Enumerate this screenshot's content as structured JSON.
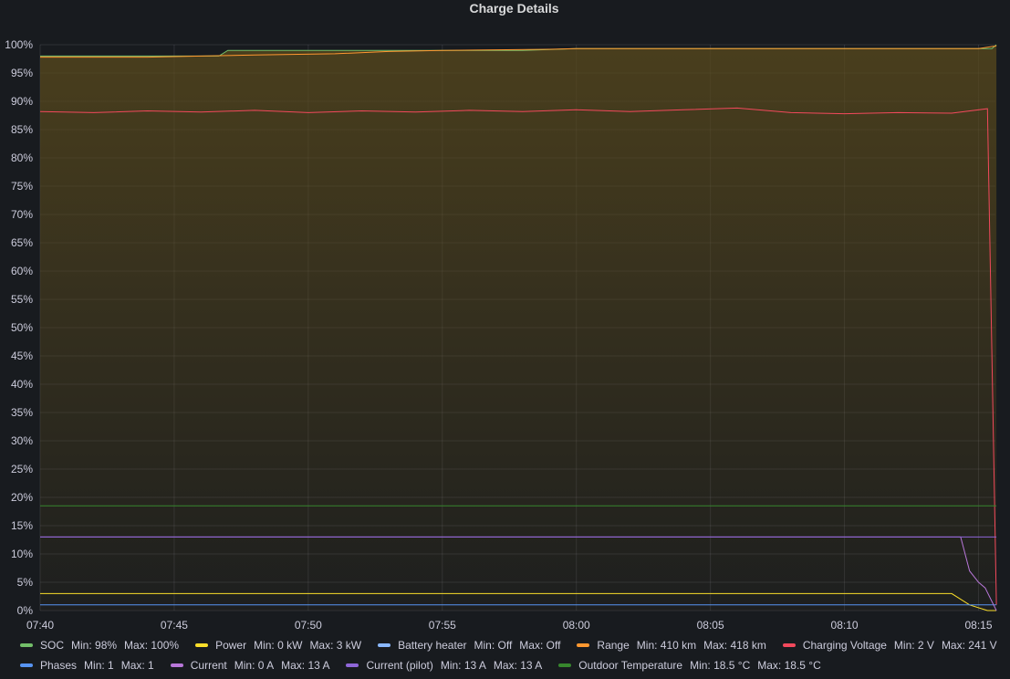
{
  "panel": {
    "title": "Charge Details"
  },
  "chart_data": {
    "type": "line",
    "title": "Charge Details",
    "xlabel": "",
    "ylabel": "",
    "ylim": [
      0,
      100
    ],
    "xlim": [
      "07:40",
      "08:16"
    ],
    "y_ticks": [
      "0%",
      "5%",
      "10%",
      "15%",
      "20%",
      "25%",
      "30%",
      "35%",
      "40%",
      "45%",
      "50%",
      "55%",
      "60%",
      "65%",
      "70%",
      "75%",
      "80%",
      "85%",
      "90%",
      "95%",
      "100%"
    ],
    "x_ticks": [
      "07:40",
      "07:45",
      "07:50",
      "07:55",
      "08:00",
      "08:05",
      "08:10",
      "08:15"
    ],
    "grid": true,
    "legend_position": "bottom",
    "series": [
      {
        "name": "SOC",
        "color": "#73bf69",
        "stats": {
          "min_label": "Min:",
          "min": "98%",
          "max_label": "Max:",
          "max": "100%"
        },
        "x": [
          "07:40",
          "07:46:40",
          "07:47",
          "07:52",
          "07:58",
          "08:00",
          "08:15:30",
          "08:15:40"
        ],
        "values": [
          98,
          98,
          99,
          99,
          99,
          99.3,
          99.3,
          100
        ],
        "fill": true
      },
      {
        "name": "Power",
        "color": "#fade2a",
        "stats": {
          "min_label": "Min:",
          "min": "0 kW",
          "max_label": "Max:",
          "max": "3 kW"
        },
        "x": [
          "07:40",
          "08:14",
          "08:14:40",
          "08:15:20",
          "08:15:40"
        ],
        "values": [
          3,
          3,
          1,
          0,
          0
        ]
      },
      {
        "name": "Battery heater",
        "color": "#8ab8ff",
        "stats": {
          "min_label": "Min:",
          "min": "Off",
          "max_label": "Max:",
          "max": "Off"
        },
        "x": [],
        "values": []
      },
      {
        "name": "Range",
        "color": "#ff9830",
        "stats": {
          "min_label": "Min:",
          "min": "410 km",
          "max_label": "Max:",
          "max": "418 km"
        },
        "x": [
          "07:40",
          "07:44",
          "07:46",
          "07:48",
          "07:51",
          "07:53",
          "07:55",
          "07:57",
          "07:59",
          "08:00",
          "08:15",
          "08:15:40"
        ],
        "values": [
          97.8,
          97.8,
          98,
          98.2,
          98.4,
          98.8,
          99,
          99.1,
          99.2,
          99.3,
          99.3,
          99.8
        ]
      },
      {
        "name": "Charging Voltage",
        "color": "#f2495c",
        "stats": {
          "min_label": "Min:",
          "min": "2 V",
          "max_label": "Max:",
          "max": "241 V"
        },
        "x": [
          "07:40",
          "07:42",
          "07:44",
          "07:46",
          "07:48",
          "07:50",
          "07:52",
          "07:54",
          "07:56",
          "07:58",
          "08:00",
          "08:02",
          "08:04",
          "08:06",
          "08:08",
          "08:10",
          "08:12",
          "08:14",
          "08:15:20",
          "08:15:40"
        ],
        "values": [
          88.2,
          88.0,
          88.3,
          88.1,
          88.4,
          88.0,
          88.3,
          88.1,
          88.4,
          88.2,
          88.5,
          88.2,
          88.5,
          88.8,
          88.0,
          87.8,
          88.0,
          87.9,
          88.7,
          1
        ]
      },
      {
        "name": "Phases",
        "color": "#5794f2",
        "stats": {
          "min_label": "Min:",
          "min": "1",
          "max_label": "Max:",
          "max": "1"
        },
        "x": [
          "07:40",
          "08:15:40"
        ],
        "values": [
          1,
          1
        ]
      },
      {
        "name": "Current",
        "color": "#b877d9",
        "stats": {
          "min_label": "Min:",
          "min": "0 A",
          "max_label": "Max:",
          "max": "13 A"
        },
        "x": [
          "07:40",
          "08:14:20",
          "08:14:40",
          "08:15",
          "08:15:15",
          "08:15:40"
        ],
        "values": [
          13,
          13,
          7,
          5,
          4,
          0
        ]
      },
      {
        "name": "Current (pilot)",
        "color": "#8f66d8",
        "stats": {
          "min_label": "Min:",
          "min": "13 A",
          "max_label": "Max:",
          "max": "13 A"
        },
        "x": [
          "07:40",
          "08:15:40"
        ],
        "values": [
          13,
          13
        ]
      },
      {
        "name": "Outdoor Temperature",
        "color": "#37872d",
        "stats": {
          "min_label": "Min:",
          "min": "18.5 °C",
          "max_label": "Max:",
          "max": "18.5 °C"
        },
        "x": [
          "07:40",
          "08:15:40"
        ],
        "values": [
          18.5,
          18.5
        ]
      }
    ]
  }
}
